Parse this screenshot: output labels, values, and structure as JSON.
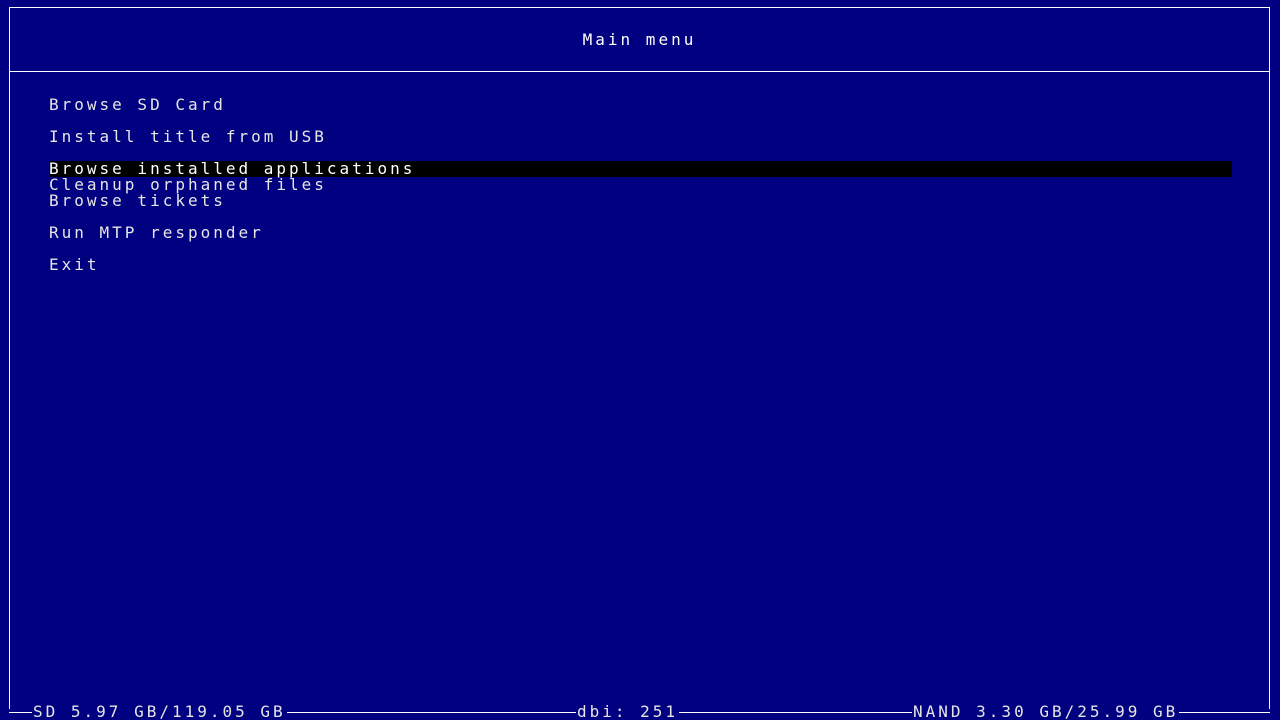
{
  "header": {
    "title": "Main menu"
  },
  "menu": {
    "items": [
      {
        "label": "Browse SD Card"
      },
      {
        "label": "Install title from USB"
      },
      {
        "label": "Browse installed applications",
        "selected": true
      },
      {
        "label": "Cleanup orphaned files"
      },
      {
        "label": "Browse tickets"
      },
      {
        "label": "Run MTP responder"
      },
      {
        "label": "Exit"
      }
    ]
  },
  "status": {
    "sd": "SD 5.97 GB/119.05 GB",
    "dbi": "dbi: 251",
    "nand": "NAND 3.30 GB/25.99 GB"
  },
  "colors": {
    "background": "#000080",
    "selection": "#000000",
    "border": "#ffffff"
  }
}
